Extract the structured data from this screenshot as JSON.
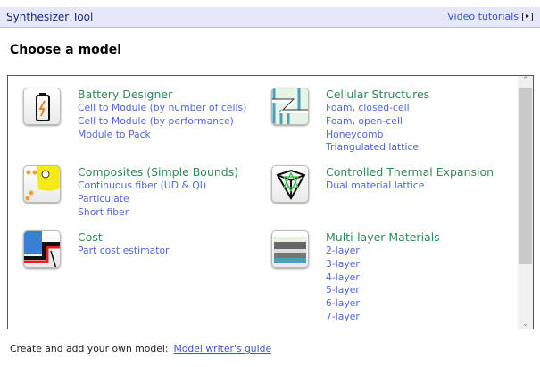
{
  "header": {
    "title": "Synthesizer Tool",
    "video_link": "Video tutorials"
  },
  "heading": "Choose a model",
  "models": [
    {
      "title": "Battery Designer",
      "items": [
        "Cell to Module (by number of cells)",
        "Cell to Module (by performance)",
        "Module to Pack"
      ]
    },
    {
      "title": "Composites (Simple Bounds)",
      "items": [
        "Continuous fiber (UD & QI)",
        "Particulate",
        "Short fiber"
      ]
    },
    {
      "title": "Cost",
      "items": [
        "Part cost estimator"
      ]
    },
    {
      "title": "Cellular Structures",
      "items": [
        "Foam, closed-cell",
        "Foam, open-cell",
        "Honeycomb",
        "Triangulated lattice"
      ]
    },
    {
      "title": "Controlled Thermal Expansion",
      "items": [
        "Dual material lattice"
      ]
    },
    {
      "title": "Multi-layer Materials",
      "items": [
        "2-layer",
        "3-layer",
        "4-layer",
        "5-layer",
        "6-layer",
        "7-layer"
      ]
    }
  ],
  "footer": {
    "text": "Create and add your own model:",
    "link": "Model writer's guide"
  }
}
